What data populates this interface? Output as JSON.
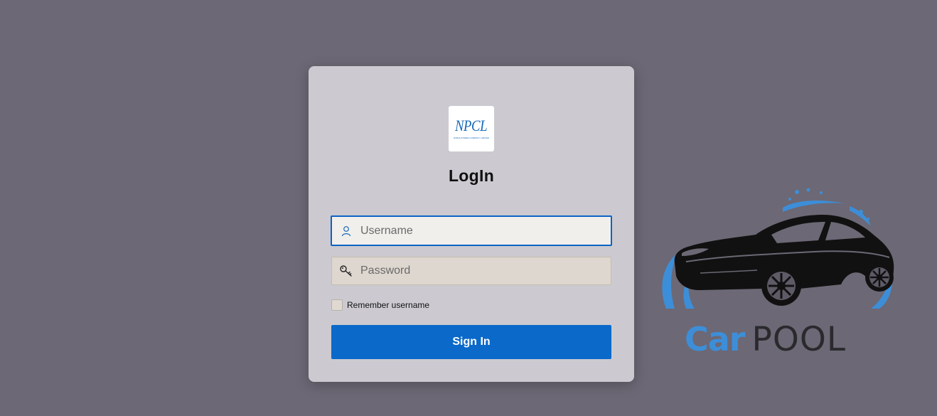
{
  "logo": {
    "text": "NPCL",
    "subtext": "NOIDA POWER COMPANY LIMITED"
  },
  "login": {
    "title": "LogIn",
    "username_placeholder": "Username",
    "password_placeholder": "Password",
    "remember_label": "Remember username",
    "remember_checked": false,
    "signin_label": "Sign In"
  },
  "brand": {
    "word_car": "Car",
    "word_pool": "POOL",
    "icon": "sports-car-with-water-splash"
  },
  "colors": {
    "background": "#6c6875",
    "card": "#cccad0",
    "primary": "#0a69c9",
    "brand_blue": "#3d8ed8"
  }
}
